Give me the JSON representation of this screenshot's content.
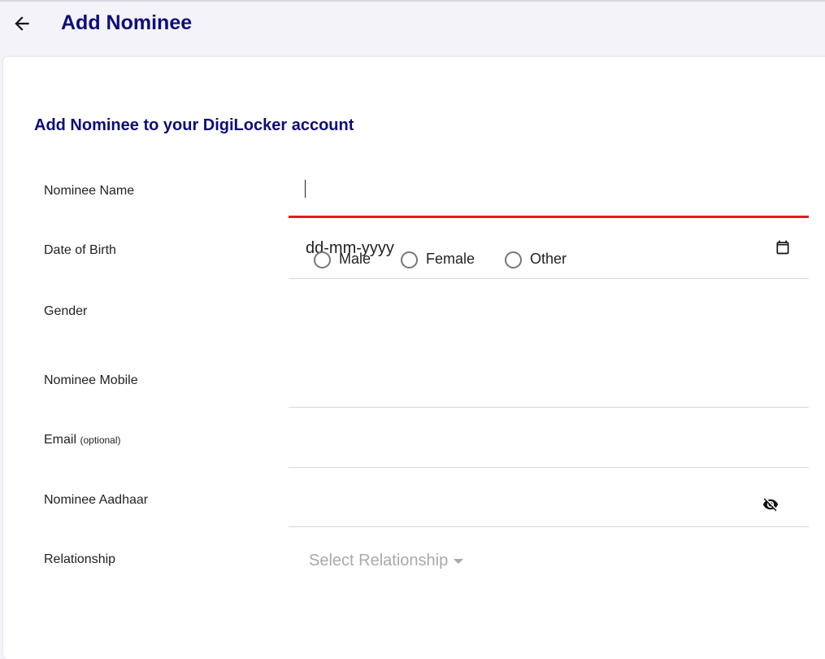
{
  "header": {
    "title": "Add Nominee",
    "back_icon": "arrow-left-icon"
  },
  "form": {
    "heading": "Add Nominee to your DigiLocker account",
    "nominee_name": {
      "label": "Nominee Name",
      "value": ""
    },
    "dob": {
      "label": "Date of Birth",
      "placeholder": "dd-mm-yyyy",
      "icon": "calendar-icon"
    },
    "gender": {
      "label": "Gender",
      "options": [
        "Male",
        "Female",
        "Other"
      ],
      "selected": null
    },
    "mobile": {
      "label": "Nominee Mobile",
      "value": ""
    },
    "email": {
      "label": "Email",
      "hint": "(optional)",
      "value": ""
    },
    "aadhaar": {
      "label": "Nominee Aadhaar",
      "value": "",
      "icon": "eye-off-icon"
    },
    "relationship": {
      "label": "Relationship",
      "placeholder": "Select Relationship"
    }
  },
  "colors": {
    "title": "#0d0d7a",
    "active_underline": "#e31b23",
    "background": "#f4f3fa"
  }
}
